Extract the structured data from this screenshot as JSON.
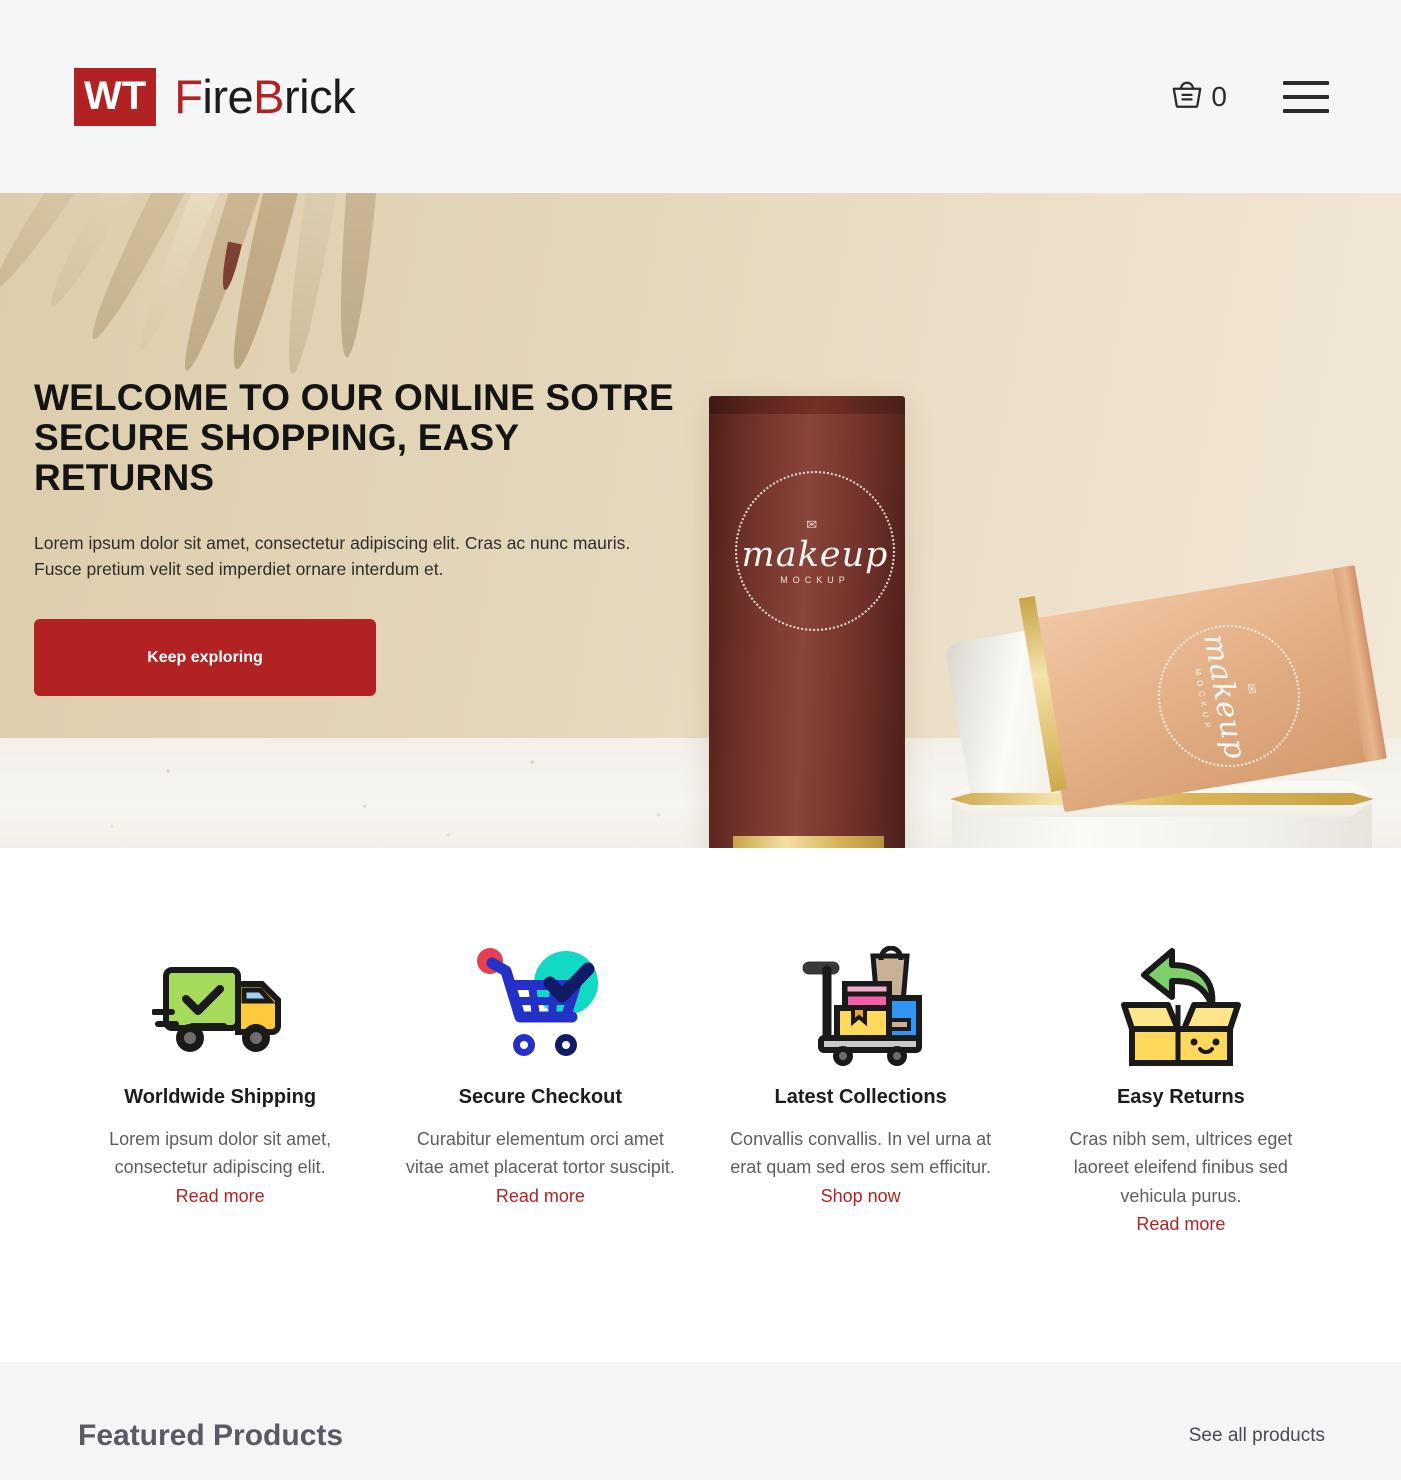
{
  "header": {
    "brand_badge": "WT",
    "brand_name_parts": {
      "p1": "F",
      "p2": "ire",
      "p3": "B",
      "p4": "rick"
    },
    "brand_full": "WT FireBrick",
    "cart_icon": "shopping-basket-icon",
    "cart_count": "0",
    "menu_icon": "hamburger-menu-icon"
  },
  "hero": {
    "title_line1": "WELCOME TO OUR ONLINE SOTRE",
    "title_line2": "SECURE SHOPPING, EASY RETURNS",
    "subtitle": "Lorem ipsum dolor sit amet, consectetur adipiscing elit. Cras ac nunc mauris. Fusce pretium velit sed imperdiet ornare interdum et.",
    "cta_label": "Keep exploring",
    "accent_color": "#b22222",
    "background_color": "#e2d3b4",
    "product_label_script": "makeup",
    "product_label_sub": "MOCKUP"
  },
  "features": [
    {
      "icon": "delivery-truck-icon",
      "title": "Worldwide Shipping",
      "text": "Lorem ipsum dolor sit amet, consectetur adipiscing elit.",
      "link": "Read more"
    },
    {
      "icon": "shopping-cart-check-icon",
      "title": "Secure Checkout",
      "text": "Curabitur elementum orci amet vitae amet placerat tortor suscipit.",
      "link": "Read more"
    },
    {
      "icon": "luggage-cart-icon",
      "title": "Latest Collections",
      "text": "Convallis convallis. In vel urna at erat quam sed eros sem efficitur.",
      "link": "Shop now"
    },
    {
      "icon": "return-box-icon",
      "title": "Easy Returns",
      "text": "Cras nibh sem, ultrices eget laoreet eleifend finibus sed vehicula purus.",
      "link": "Read more"
    }
  ],
  "featured": {
    "title": "Featured Products",
    "see_all_label": "See all products"
  }
}
